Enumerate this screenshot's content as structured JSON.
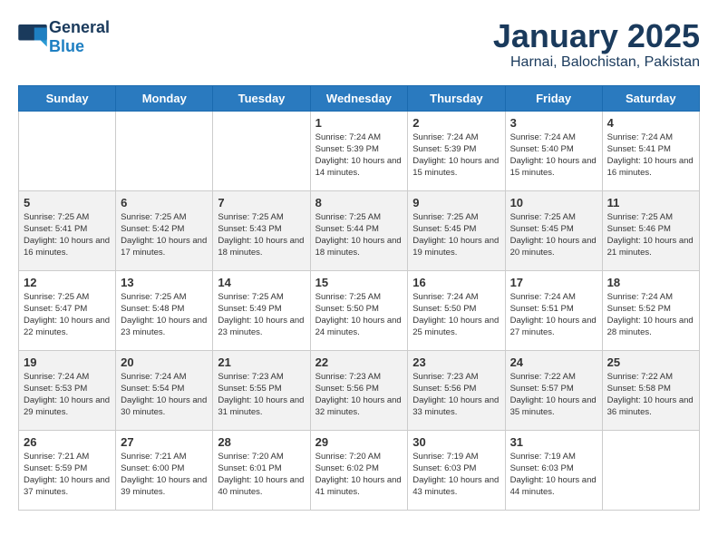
{
  "header": {
    "logo_line1": "General",
    "logo_line2": "Blue",
    "month": "January 2025",
    "location": "Harnai, Balochistan, Pakistan"
  },
  "days_of_week": [
    "Sunday",
    "Monday",
    "Tuesday",
    "Wednesday",
    "Thursday",
    "Friday",
    "Saturday"
  ],
  "weeks": [
    [
      {
        "num": "",
        "info": ""
      },
      {
        "num": "",
        "info": ""
      },
      {
        "num": "",
        "info": ""
      },
      {
        "num": "1",
        "info": "Sunrise: 7:24 AM\nSunset: 5:39 PM\nDaylight: 10 hours\nand 14 minutes."
      },
      {
        "num": "2",
        "info": "Sunrise: 7:24 AM\nSunset: 5:39 PM\nDaylight: 10 hours\nand 15 minutes."
      },
      {
        "num": "3",
        "info": "Sunrise: 7:24 AM\nSunset: 5:40 PM\nDaylight: 10 hours\nand 15 minutes."
      },
      {
        "num": "4",
        "info": "Sunrise: 7:24 AM\nSunset: 5:41 PM\nDaylight: 10 hours\nand 16 minutes."
      }
    ],
    [
      {
        "num": "5",
        "info": "Sunrise: 7:25 AM\nSunset: 5:41 PM\nDaylight: 10 hours\nand 16 minutes."
      },
      {
        "num": "6",
        "info": "Sunrise: 7:25 AM\nSunset: 5:42 PM\nDaylight: 10 hours\nand 17 minutes."
      },
      {
        "num": "7",
        "info": "Sunrise: 7:25 AM\nSunset: 5:43 PM\nDaylight: 10 hours\nand 18 minutes."
      },
      {
        "num": "8",
        "info": "Sunrise: 7:25 AM\nSunset: 5:44 PM\nDaylight: 10 hours\nand 18 minutes."
      },
      {
        "num": "9",
        "info": "Sunrise: 7:25 AM\nSunset: 5:45 PM\nDaylight: 10 hours\nand 19 minutes."
      },
      {
        "num": "10",
        "info": "Sunrise: 7:25 AM\nSunset: 5:45 PM\nDaylight: 10 hours\nand 20 minutes."
      },
      {
        "num": "11",
        "info": "Sunrise: 7:25 AM\nSunset: 5:46 PM\nDaylight: 10 hours\nand 21 minutes."
      }
    ],
    [
      {
        "num": "12",
        "info": "Sunrise: 7:25 AM\nSunset: 5:47 PM\nDaylight: 10 hours\nand 22 minutes."
      },
      {
        "num": "13",
        "info": "Sunrise: 7:25 AM\nSunset: 5:48 PM\nDaylight: 10 hours\nand 23 minutes."
      },
      {
        "num": "14",
        "info": "Sunrise: 7:25 AM\nSunset: 5:49 PM\nDaylight: 10 hours\nand 23 minutes."
      },
      {
        "num": "15",
        "info": "Sunrise: 7:25 AM\nSunset: 5:50 PM\nDaylight: 10 hours\nand 24 minutes."
      },
      {
        "num": "16",
        "info": "Sunrise: 7:24 AM\nSunset: 5:50 PM\nDaylight: 10 hours\nand 25 minutes."
      },
      {
        "num": "17",
        "info": "Sunrise: 7:24 AM\nSunset: 5:51 PM\nDaylight: 10 hours\nand 27 minutes."
      },
      {
        "num": "18",
        "info": "Sunrise: 7:24 AM\nSunset: 5:52 PM\nDaylight: 10 hours\nand 28 minutes."
      }
    ],
    [
      {
        "num": "19",
        "info": "Sunrise: 7:24 AM\nSunset: 5:53 PM\nDaylight: 10 hours\nand 29 minutes."
      },
      {
        "num": "20",
        "info": "Sunrise: 7:24 AM\nSunset: 5:54 PM\nDaylight: 10 hours\nand 30 minutes."
      },
      {
        "num": "21",
        "info": "Sunrise: 7:23 AM\nSunset: 5:55 PM\nDaylight: 10 hours\nand 31 minutes."
      },
      {
        "num": "22",
        "info": "Sunrise: 7:23 AM\nSunset: 5:56 PM\nDaylight: 10 hours\nand 32 minutes."
      },
      {
        "num": "23",
        "info": "Sunrise: 7:23 AM\nSunset: 5:56 PM\nDaylight: 10 hours\nand 33 minutes."
      },
      {
        "num": "24",
        "info": "Sunrise: 7:22 AM\nSunset: 5:57 PM\nDaylight: 10 hours\nand 35 minutes."
      },
      {
        "num": "25",
        "info": "Sunrise: 7:22 AM\nSunset: 5:58 PM\nDaylight: 10 hours\nand 36 minutes."
      }
    ],
    [
      {
        "num": "26",
        "info": "Sunrise: 7:21 AM\nSunset: 5:59 PM\nDaylight: 10 hours\nand 37 minutes."
      },
      {
        "num": "27",
        "info": "Sunrise: 7:21 AM\nSunset: 6:00 PM\nDaylight: 10 hours\nand 39 minutes."
      },
      {
        "num": "28",
        "info": "Sunrise: 7:20 AM\nSunset: 6:01 PM\nDaylight: 10 hours\nand 40 minutes."
      },
      {
        "num": "29",
        "info": "Sunrise: 7:20 AM\nSunset: 6:02 PM\nDaylight: 10 hours\nand 41 minutes."
      },
      {
        "num": "30",
        "info": "Sunrise: 7:19 AM\nSunset: 6:03 PM\nDaylight: 10 hours\nand 43 minutes."
      },
      {
        "num": "31",
        "info": "Sunrise: 7:19 AM\nSunset: 6:03 PM\nDaylight: 10 hours\nand 44 minutes."
      },
      {
        "num": "",
        "info": ""
      }
    ]
  ]
}
